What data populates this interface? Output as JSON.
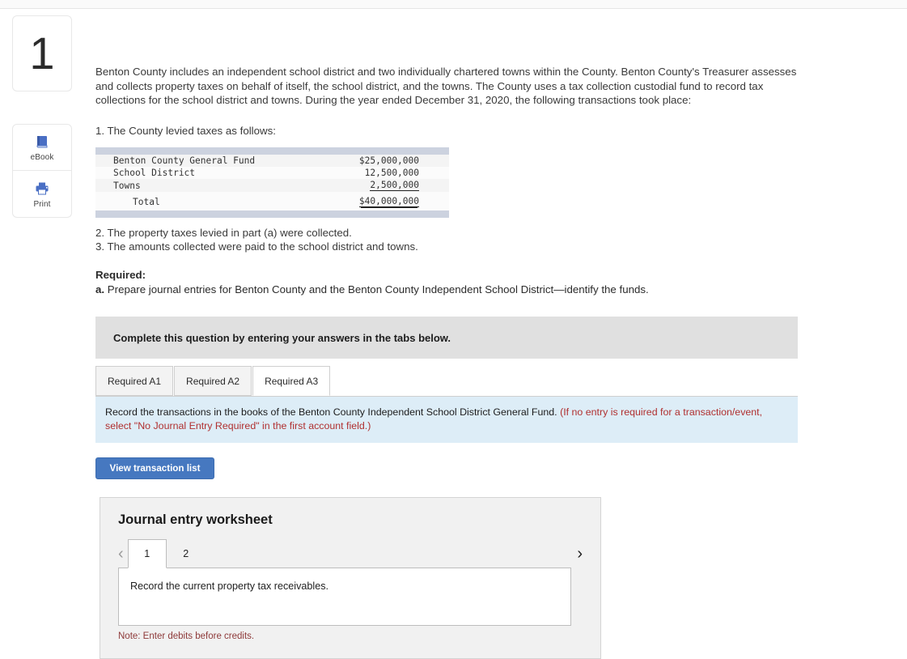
{
  "question": {
    "number": "1"
  },
  "tools": [
    {
      "label": "eBook",
      "icon": "book-icon"
    },
    {
      "label": "Print",
      "icon": "printer-icon"
    }
  ],
  "problem": {
    "intro": "Benton County includes an independent school district and two individually chartered towns within the County. Benton County's Treasurer assesses and collects property taxes on behalf of itself, the school district, and the towns. The County uses a tax collection custodial fund to record tax collections for the school district and towns. During the year ended December 31, 2020, the following transactions took place:",
    "item1": "1. The County levied taxes as follows:",
    "item2": "2. The property taxes levied in part (a) were collected.",
    "item3": "3. The amounts collected were paid to the school district and towns.",
    "required_heading": "Required:",
    "required_letter": "a.",
    "required_text": "Prepare journal entries for Benton County and the Benton County Independent School District—identify the funds."
  },
  "levy_table": {
    "rows": [
      {
        "label": "Benton County General Fund",
        "amount": "$25,000,000",
        "rule": "none",
        "indent": false
      },
      {
        "label": "School District",
        "amount": "12,500,000",
        "rule": "none",
        "indent": false
      },
      {
        "label": "Towns",
        "amount": "2,500,000",
        "rule": "single",
        "indent": false
      },
      {
        "label": "Total",
        "amount": "$40,000,000",
        "rule": "double",
        "indent": true
      }
    ]
  },
  "complete_banner": {
    "text": "Complete this question by entering your answers in the tabs below."
  },
  "required_tabs": [
    {
      "label": "Required A1",
      "active": false
    },
    {
      "label": "Required A2",
      "active": false
    },
    {
      "label": "Required A3",
      "active": true
    }
  ],
  "record_banner": {
    "main": "Record the transactions in the books of the Benton County Independent School District General Fund.",
    "note": "(If no entry is required for a transaction/event, select \"No Journal Entry Required\" in the first account field.)"
  },
  "view_transaction_button": {
    "label": "View transaction list"
  },
  "journal_worksheet": {
    "title": "Journal entry worksheet",
    "prev_icon": "chevron-left-icon",
    "next_icon": "chevron-right-icon",
    "entry_tabs": [
      {
        "label": "1",
        "active": true
      },
      {
        "label": "2",
        "active": false
      }
    ],
    "body_text": "Record the current property tax receivables.",
    "note": "Note: Enter debits before credits."
  },
  "colors": {
    "accent_blue": "#4678c0",
    "info_banner": "#ddedf7",
    "grey_banner": "#e0e0e0",
    "table_bar": "#ccd2df",
    "note_red": "#b03030"
  }
}
